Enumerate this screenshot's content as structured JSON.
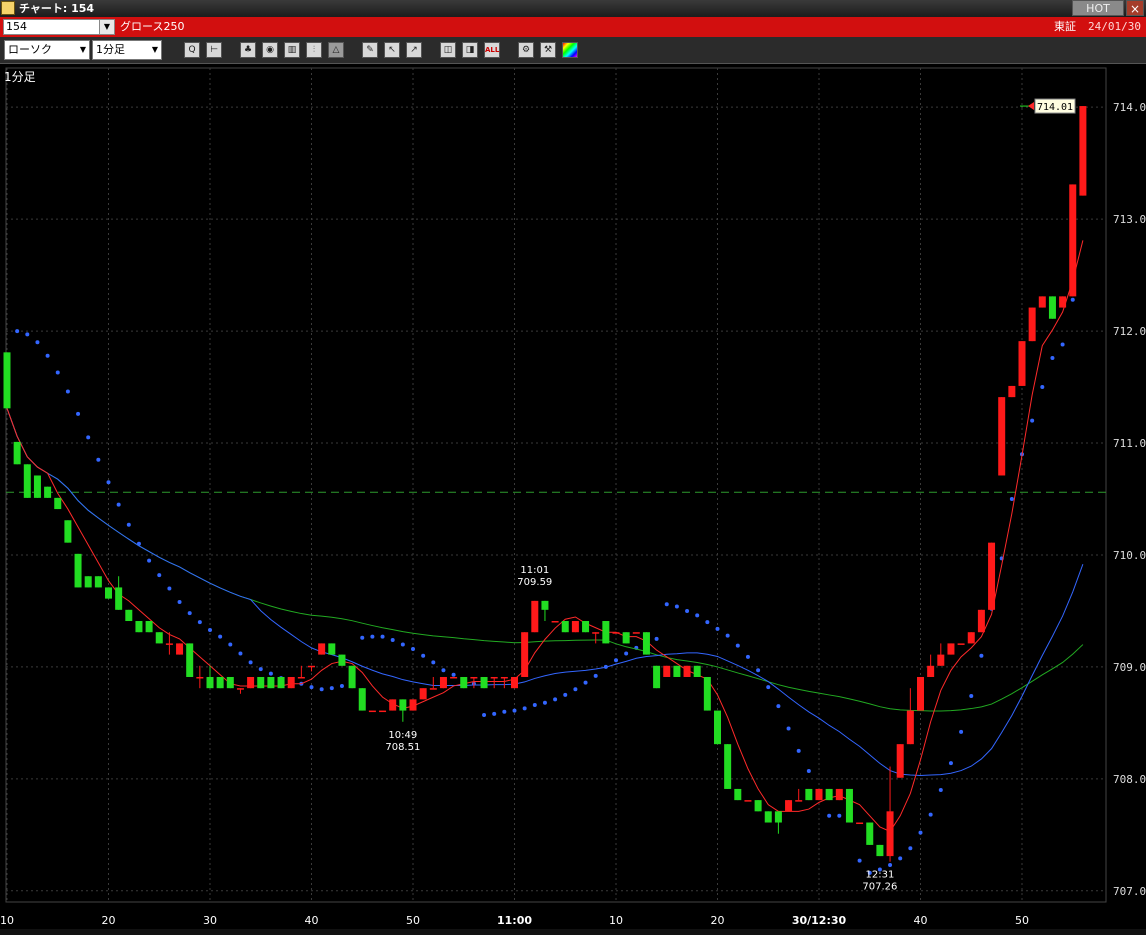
{
  "window": {
    "title": "チャート: 154",
    "hot_label": "HOT",
    "close_label": "×"
  },
  "header": {
    "code": "154",
    "name": "グロース250",
    "market": "東証",
    "date": "24/01/30"
  },
  "toolbar": {
    "chart_type": "ローソク",
    "interval": "1分足",
    "icons": [
      "zoom-icon",
      "cursor-icon",
      "fund-icon",
      "search-icon",
      "indicator-icon",
      "split-icon",
      "erase-icon",
      "draw-line-icon",
      "pointer-icon",
      "arrow-icon",
      "candle-width-icon",
      "candle-fit-icon",
      "all-icon",
      "settings-icon",
      "tool-icon",
      "color-icon"
    ],
    "all_label": "ALL"
  },
  "chart_data": {
    "type": "candlestick",
    "interval_label": "1分足",
    "ylim": [
      706.9,
      714.35
    ],
    "y_ticks": [
      "714.00",
      "713.00",
      "712.00",
      "711.00",
      "710.00",
      "709.00",
      "708.00",
      "707.00"
    ],
    "x_ticks": [
      "10",
      "20",
      "30",
      "40",
      "50",
      "11:00",
      "10",
      "20",
      "30/12:30",
      "40",
      "50"
    ],
    "last_price": "714.01",
    "reference_line": 710.56,
    "annotations": [
      {
        "time": "11:01",
        "price": "709.59"
      },
      {
        "time": "10:49",
        "price": "708.51"
      },
      {
        "time": "12:31",
        "price": "707.26"
      }
    ],
    "colors": {
      "up": "#ff1a1a",
      "down": "#22dd22",
      "ma_short": "#ff2a2a",
      "ma_mid": "#3366ff",
      "ma_long": "#22aa22",
      "sar": "#3366ff",
      "grid": "#3a3a3a"
    },
    "candles": [
      [
        711.81,
        711.31,
        711.81,
        711.31
      ],
      [
        711.01,
        710.81,
        711.01,
        710.81
      ],
      [
        710.81,
        710.51,
        710.81,
        710.51
      ],
      [
        710.71,
        710.51,
        710.71,
        710.51
      ],
      [
        710.61,
        710.51,
        710.61,
        710.51
      ],
      [
        710.51,
        710.41,
        710.51,
        710.41
      ],
      [
        710.31,
        710.11,
        710.31,
        710.11
      ],
      [
        710.01,
        709.71,
        710.01,
        709.71
      ],
      [
        709.81,
        709.71,
        709.81,
        709.71
      ],
      [
        709.81,
        709.71,
        709.81,
        709.71
      ],
      [
        709.71,
        709.61,
        709.71,
        709.61
      ],
      [
        709.71,
        709.51,
        709.81,
        709.51
      ],
      [
        709.51,
        709.41,
        709.51,
        709.41
      ],
      [
        709.41,
        709.31,
        709.41,
        709.31
      ],
      [
        709.41,
        709.31,
        709.41,
        709.31
      ],
      [
        709.31,
        709.21,
        709.31,
        709.21
      ],
      [
        709.21,
        709.21,
        709.31,
        709.11
      ],
      [
        709.11,
        709.21,
        709.21,
        709.11
      ],
      [
        709.21,
        708.91,
        709.21,
        708.91
      ],
      [
        708.91,
        708.91,
        709.01,
        708.81
      ],
      [
        708.91,
        708.81,
        709.01,
        708.81
      ],
      [
        708.91,
        708.81,
        708.91,
        708.81
      ],
      [
        708.91,
        708.81,
        708.91,
        708.81
      ],
      [
        708.81,
        708.81,
        708.81,
        708.76
      ],
      [
        708.81,
        708.91,
        708.91,
        708.81
      ],
      [
        708.91,
        708.81,
        708.91,
        708.81
      ],
      [
        708.91,
        708.81,
        708.91,
        708.81
      ],
      [
        708.91,
        708.81,
        708.91,
        708.81
      ],
      [
        708.81,
        708.91,
        708.91,
        708.81
      ],
      [
        708.91,
        708.91,
        709.01,
        708.91
      ],
      [
        709.01,
        709.01,
        709.01,
        708.96
      ],
      [
        709.11,
        709.21,
        709.21,
        709.11
      ],
      [
        709.21,
        709.11,
        709.21,
        709.11
      ],
      [
        709.11,
        709.01,
        709.11,
        709.01
      ],
      [
        709.01,
        708.81,
        709.01,
        708.81
      ],
      [
        708.81,
        708.61,
        708.81,
        708.61
      ],
      [
        708.61,
        708.61,
        708.61,
        708.61
      ],
      [
        708.61,
        708.61,
        708.61,
        708.61
      ],
      [
        708.61,
        708.71,
        708.71,
        708.61
      ],
      [
        708.71,
        708.61,
        708.71,
        708.51
      ],
      [
        708.61,
        708.71,
        708.71,
        708.61
      ],
      [
        708.71,
        708.81,
        708.81,
        708.71
      ],
      [
        708.81,
        708.81,
        708.91,
        708.81
      ],
      [
        708.81,
        708.91,
        708.91,
        708.81
      ],
      [
        708.91,
        708.91,
        708.91,
        708.91
      ],
      [
        708.91,
        708.81,
        708.91,
        708.81
      ],
      [
        708.91,
        708.91,
        708.91,
        708.81
      ],
      [
        708.91,
        708.81,
        708.91,
        708.81
      ],
      [
        708.91,
        708.91,
        708.91,
        708.81
      ],
      [
        708.91,
        708.91,
        708.91,
        708.81
      ],
      [
        708.81,
        708.91,
        708.91,
        708.81
      ],
      [
        708.91,
        709.31,
        709.31,
        708.91
      ],
      [
        709.31,
        709.59,
        709.59,
        709.31
      ],
      [
        709.59,
        709.51,
        709.59,
        709.41
      ],
      [
        709.41,
        709.41,
        709.41,
        709.41
      ],
      [
        709.41,
        709.31,
        709.41,
        709.31
      ],
      [
        709.31,
        709.41,
        709.41,
        709.31
      ],
      [
        709.41,
        709.31,
        709.41,
        709.31
      ],
      [
        709.31,
        709.31,
        709.31,
        709.21
      ],
      [
        709.41,
        709.21,
        709.41,
        709.21
      ],
      [
        709.31,
        709.31,
        709.31,
        709.31
      ],
      [
        709.31,
        709.21,
        709.31,
        709.21
      ],
      [
        709.31,
        709.31,
        709.31,
        709.31
      ],
      [
        709.31,
        709.11,
        709.31,
        709.11
      ],
      [
        709.01,
        708.81,
        709.01,
        708.81
      ],
      [
        708.91,
        709.01,
        709.01,
        708.91
      ],
      [
        709.01,
        708.91,
        709.01,
        708.91
      ],
      [
        708.91,
        709.01,
        709.01,
        708.91
      ],
      [
        709.01,
        708.91,
        709.01,
        708.91
      ],
      [
        708.91,
        708.61,
        708.91,
        708.61
      ],
      [
        708.61,
        708.31,
        708.61,
        708.31
      ],
      [
        708.31,
        707.91,
        708.31,
        707.91
      ],
      [
        707.91,
        707.81,
        707.91,
        707.81
      ],
      [
        707.81,
        707.81,
        707.81,
        707.81
      ],
      [
        707.81,
        707.71,
        707.81,
        707.71
      ],
      [
        707.71,
        707.61,
        707.71,
        707.61
      ],
      [
        707.71,
        707.61,
        707.71,
        707.51
      ],
      [
        707.71,
        707.81,
        707.81,
        707.71
      ],
      [
        707.81,
        707.81,
        707.91,
        707.81
      ],
      [
        707.91,
        707.81,
        707.91,
        707.81
      ],
      [
        707.81,
        707.91,
        707.91,
        707.81
      ],
      [
        707.91,
        707.81,
        707.91,
        707.81
      ],
      [
        707.81,
        707.91,
        707.91,
        707.81
      ],
      [
        707.91,
        707.61,
        707.91,
        707.61
      ],
      [
        707.61,
        707.61,
        707.61,
        707.61
      ],
      [
        707.61,
        707.41,
        707.61,
        707.41
      ],
      [
        707.41,
        707.31,
        707.41,
        707.31
      ],
      [
        707.31,
        707.71,
        708.11,
        707.26
      ],
      [
        708.01,
        708.31,
        708.31,
        708.01
      ],
      [
        708.31,
        708.61,
        708.81,
        708.31
      ],
      [
        708.61,
        708.91,
        708.91,
        708.61
      ],
      [
        708.91,
        709.01,
        709.11,
        708.91
      ],
      [
        709.01,
        709.11,
        709.21,
        709.01
      ],
      [
        709.11,
        709.21,
        709.21,
        709.11
      ],
      [
        709.21,
        709.21,
        709.21,
        709.21
      ],
      [
        709.21,
        709.31,
        709.31,
        709.21
      ],
      [
        709.31,
        709.51,
        709.51,
        709.31
      ],
      [
        709.51,
        710.11,
        710.11,
        709.51
      ],
      [
        710.71,
        711.41,
        711.41,
        710.71
      ],
      [
        711.41,
        711.51,
        711.51,
        711.41
      ],
      [
        711.51,
        711.91,
        711.91,
        711.51
      ],
      [
        711.91,
        712.21,
        712.21,
        711.91
      ],
      [
        712.21,
        712.31,
        712.31,
        712.21
      ],
      [
        712.31,
        712.11,
        712.31,
        712.11
      ],
      [
        712.21,
        712.31,
        712.31,
        712.21
      ],
      [
        712.31,
        713.31,
        713.31,
        712.31
      ],
      [
        713.21,
        714.01,
        714.01,
        713.21
      ]
    ],
    "candle_x_start_minute": 0,
    "sar_points": [
      712.0,
      711.97,
      711.9,
      711.78,
      711.63,
      711.46,
      711.26,
      711.05,
      710.85,
      710.65,
      710.45,
      710.27,
      710.1,
      709.95,
      709.82,
      709.7,
      709.58,
      709.48,
      709.4,
      709.33,
      709.27,
      709.2,
      709.12,
      709.04,
      708.98,
      708.94,
      708.9,
      708.87,
      708.85,
      708.82,
      708.8,
      708.81,
      708.83,
      708.86,
      709.26,
      709.27,
      709.27,
      709.24,
      709.2,
      709.16,
      709.1,
      709.04,
      708.97,
      708.93,
      708.88,
      708.85,
      708.57,
      708.58,
      708.6,
      708.61,
      708.63,
      708.66,
      708.68,
      708.71,
      708.75,
      708.8,
      708.86,
      708.92,
      709.0,
      709.06,
      709.12,
      709.17,
      709.22,
      709.25,
      709.56,
      709.54,
      709.5,
      709.46,
      709.4,
      709.34,
      709.28,
      709.19,
      709.09,
      708.97,
      708.82,
      708.65,
      708.45,
      708.25,
      708.07,
      707.85,
      707.67,
      707.67,
      707.63,
      707.27,
      707.16,
      707.19,
      707.23,
      707.29,
      707.38,
      707.52,
      707.68,
      707.9,
      708.14,
      708.42,
      708.74,
      709.1,
      709.52,
      709.97,
      710.5,
      710.9,
      711.2,
      711.5,
      711.76,
      711.88,
      712.28
    ],
    "sar_start": 1
  }
}
